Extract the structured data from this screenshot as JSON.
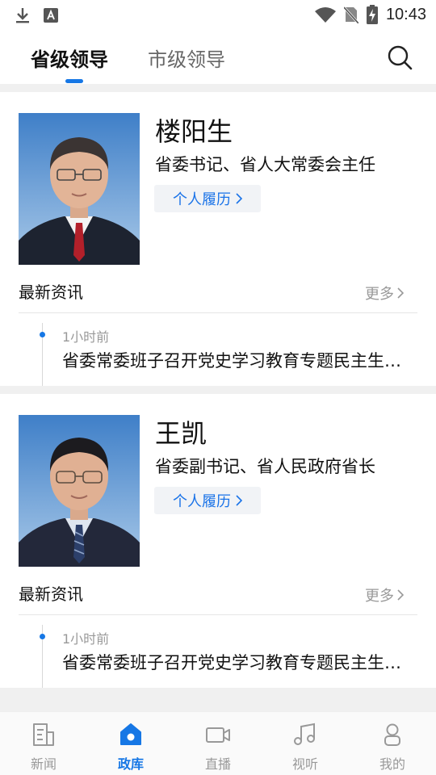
{
  "status_bar": {
    "time": "10:43",
    "left_icons": [
      "download-icon",
      "keyboard-a-icon"
    ],
    "right_icons": [
      "wifi-icon",
      "no-sim-icon",
      "battery-charging-icon"
    ]
  },
  "tabs": [
    {
      "label": "省级领导",
      "active": true
    },
    {
      "label": "市级领导",
      "active": false
    }
  ],
  "search_icon": "search-icon",
  "accent_color": "#1677e5",
  "leaders": [
    {
      "name": "楼阳生",
      "title": "省委书记、省人大常委会主任",
      "resume_label": "个人履历",
      "news_label": "最新资讯",
      "more_label": "更多",
      "news": [
        {
          "time": "1小时前",
          "headline": "省委常委班子召开党史学习教育专题民主生活会"
        }
      ]
    },
    {
      "name": "王凯",
      "title": "省委副书记、省人民政府省长",
      "resume_label": "个人履历",
      "news_label": "最新资讯",
      "more_label": "更多",
      "news": [
        {
          "time": "1小时前",
          "headline": "省委常委班子召开党史学习教育专题民主生活会"
        }
      ]
    }
  ],
  "bottom_nav": [
    {
      "label": "新闻",
      "icon": "news-icon",
      "active": false
    },
    {
      "label": "政库",
      "icon": "home-icon",
      "active": true
    },
    {
      "label": "直播",
      "icon": "video-camera-icon",
      "active": false
    },
    {
      "label": "视听",
      "icon": "music-note-icon",
      "active": false
    },
    {
      "label": "我的",
      "icon": "person-icon",
      "active": false
    }
  ]
}
